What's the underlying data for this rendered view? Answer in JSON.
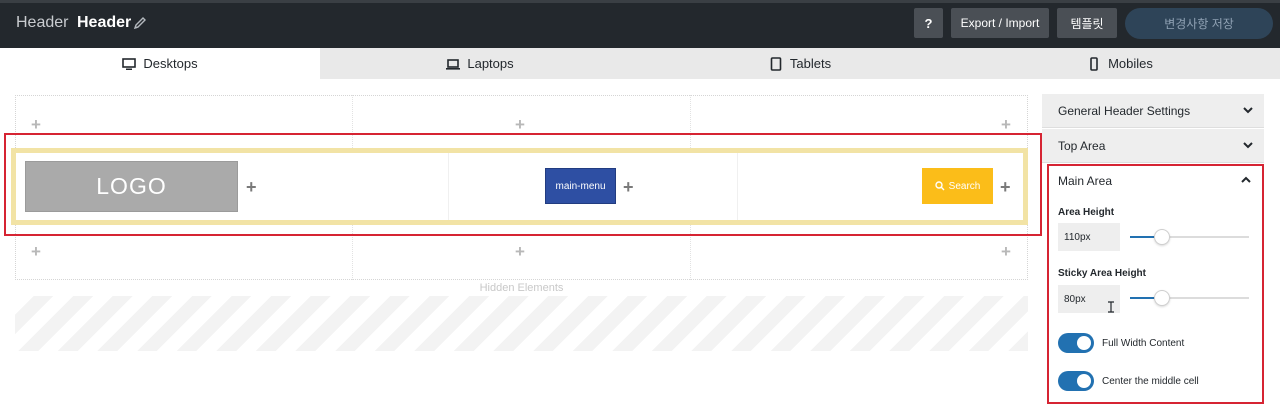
{
  "topbar": {
    "breadcrumb": "Header",
    "title": "Header",
    "help_label": "?",
    "export_label": "Export / Import",
    "templates_label": "템플릿",
    "save_label": "변경사항 저장"
  },
  "tabs": [
    {
      "label": "Desktops",
      "icon": "desktop-icon",
      "active": true
    },
    {
      "label": "Laptops",
      "icon": "laptop-icon",
      "active": false
    },
    {
      "label": "Tablets",
      "icon": "tablet-icon",
      "active": false
    },
    {
      "label": "Mobiles",
      "icon": "mobile-icon",
      "active": false
    }
  ],
  "builder": {
    "logo_label": "LOGO",
    "main_menu_label": "main-menu",
    "search_label": "Search",
    "hidden_elements_label": "Hidden Elements"
  },
  "settings": {
    "general_label": "General Header Settings",
    "top_area_label": "Top Area",
    "main_area_label": "Main Area",
    "area_height_label": "Area Height",
    "area_height_value": "110px",
    "area_height_slider": 0.27,
    "sticky_height_label": "Sticky Area Height",
    "sticky_height_value": "80px",
    "sticky_height_slider": 0.27,
    "full_width_label": "Full Width Content",
    "full_width_on": true,
    "center_middle_label": "Center the middle cell",
    "center_middle_on": true
  },
  "colors": {
    "topbar": "#23282d",
    "accent": "#2271b1",
    "logo_bg": "#aaaaaa",
    "menu_bg": "#2e4fa3",
    "search_bg": "#fbbd19",
    "highlight": "#d62433",
    "row_border": "#f2e3a5"
  }
}
